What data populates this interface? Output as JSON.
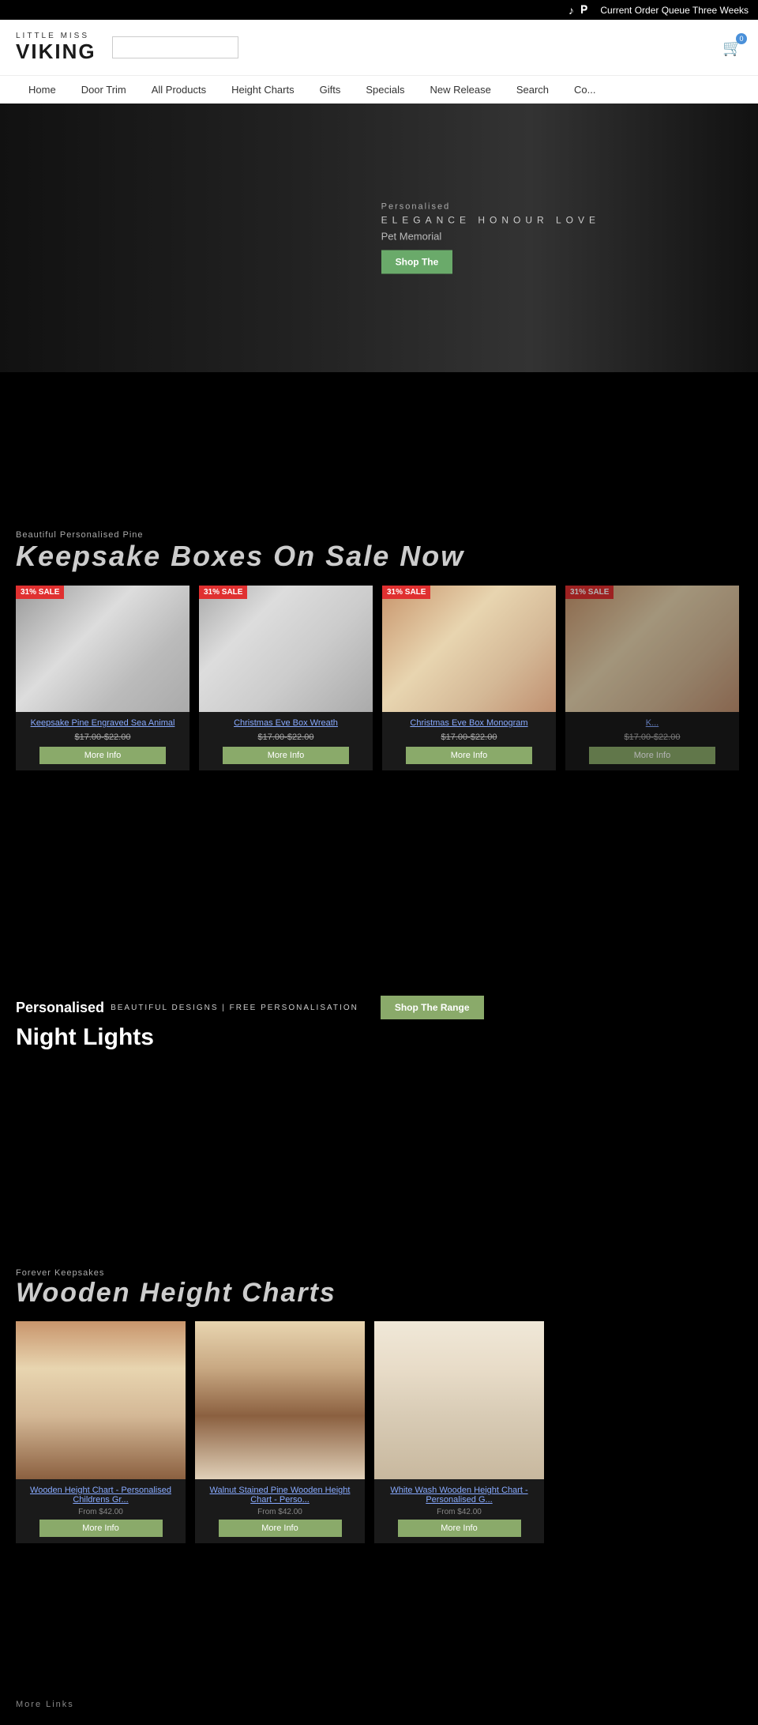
{
  "topbar": {
    "social_icons": [
      "tiktok",
      "pinterest"
    ],
    "announcement": "Current Order Queue Three Weeks"
  },
  "header": {
    "logo_top": "LITTLE MISS",
    "logo_bottom": "VIKING",
    "search_placeholder": "",
    "cart_label": "Cart"
  },
  "nav": {
    "items": [
      {
        "label": "Home",
        "id": "home"
      },
      {
        "label": "Door Trim",
        "id": "door-trim"
      },
      {
        "label": "All Products",
        "id": "all-products"
      },
      {
        "label": "Height Charts",
        "id": "height-charts"
      },
      {
        "label": "Gifts",
        "id": "gifts"
      },
      {
        "label": "Specials",
        "id": "specials"
      },
      {
        "label": "New Release",
        "id": "new-release"
      },
      {
        "label": "Search",
        "id": "search"
      },
      {
        "label": "Co...",
        "id": "contact"
      }
    ]
  },
  "hero": {
    "subtitle": "Personalised",
    "tagline": "ELEGANCE  HONOUR  LOVE",
    "description": "Pet Memorial",
    "cta_label": "Shop The"
  },
  "sale_section": {
    "subtext": "Beautiful Personalised Pine",
    "title": "Keepsake Boxes On Sale Now",
    "products": [
      {
        "name": "Keepsake Pine Engraved Sea Animal",
        "price": "$17.00-$22.00",
        "badge": "31% SALE",
        "img_type": "silver",
        "btn_label": "More Info"
      },
      {
        "name": "Christmas Eve Box Wreath",
        "price": "$17.00-$22.00",
        "badge": "31% SALE",
        "img_type": "silver",
        "btn_label": "More Info"
      },
      {
        "name": "Christmas Eve Box Monogram",
        "price": "$17.00-$22.00",
        "badge": "31% SALE",
        "img_type": "warm",
        "btn_label": "More Info"
      },
      {
        "name": "K...",
        "price": "$17.00-$22.00",
        "badge": "31% SALE",
        "img_type": "warm",
        "btn_label": "More Info"
      }
    ]
  },
  "night_lights": {
    "label": "Personalised",
    "tagline": "BEAUTIFUL DESIGNS | FREE PERSONALISATION",
    "title_line1": "Night Lights",
    "cta_label": "Shop The Range"
  },
  "height_charts": {
    "subtext": "Forever Keepsakes",
    "title": "Wooden Height Charts",
    "products": [
      {
        "name": "Wooden Height Chart - Personalised Childrens Gr...",
        "price_label": "From",
        "price": "$42.00",
        "img_type": "img1",
        "btn_label": "More Info"
      },
      {
        "name": "Walnut Stained Pine Wooden Height Chart - Perso...",
        "price_label": "From",
        "price": "$42.00",
        "img_type": "img2",
        "btn_label": "More Info"
      },
      {
        "name": "White Wash Wooden Height Chart - Personalised G...",
        "price_label": "From",
        "price": "$42.00",
        "img_type": "img3",
        "btn_label": "More Info"
      }
    ]
  },
  "footer": {
    "links_label": "More Links"
  }
}
